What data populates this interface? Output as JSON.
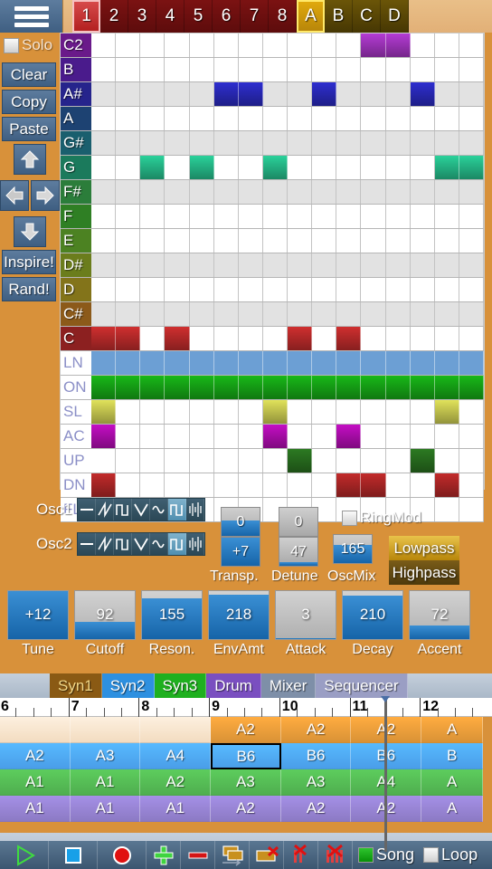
{
  "topbar": {
    "menu_icon": "hamburger-icon",
    "pattern_tabs": [
      {
        "label": "1",
        "type": "num",
        "selected": true
      },
      {
        "label": "2",
        "type": "num",
        "selected": false
      },
      {
        "label": "3",
        "type": "num",
        "selected": false
      },
      {
        "label": "4",
        "type": "num",
        "selected": false
      },
      {
        "label": "5",
        "type": "num",
        "selected": false
      },
      {
        "label": "6",
        "type": "num",
        "selected": false
      },
      {
        "label": "7",
        "type": "num",
        "selected": false
      },
      {
        "label": "8",
        "type": "num",
        "selected": false
      },
      {
        "label": "A",
        "type": "alpha",
        "selected": true
      },
      {
        "label": "B",
        "type": "alpha",
        "selected": false
      },
      {
        "label": "C",
        "type": "alpha",
        "selected": false
      },
      {
        "label": "D",
        "type": "alpha",
        "selected": false
      }
    ]
  },
  "sidebar": {
    "solo": {
      "label": "Solo",
      "checked": false
    },
    "buttons": [
      {
        "label": "Clear",
        "name": "clear-button"
      },
      {
        "label": "Copy",
        "name": "copy-button"
      },
      {
        "label": "Paste",
        "name": "paste-button"
      }
    ],
    "nudge": {
      "up": "arrow-up-icon",
      "left": "arrow-left-icon",
      "right": "arrow-right-icon",
      "down": "arrow-down-icon"
    },
    "generate": [
      {
        "label": "Inspire!",
        "name": "inspire-button"
      },
      {
        "label": "Rand!",
        "name": "rand-button"
      }
    ]
  },
  "piano_roll": {
    "columns": 16,
    "note_rows": [
      {
        "label": "C2",
        "color": "#6a1a8a",
        "shade": false,
        "steps": [
          0,
          0,
          0,
          0,
          0,
          0,
          0,
          0,
          0,
          0,
          0,
          1,
          1,
          0,
          0,
          0
        ],
        "note_color": "#b43bd4"
      },
      {
        "label": "B",
        "color": "#4a1b8c",
        "shade": false,
        "steps": [
          0,
          0,
          0,
          0,
          0,
          0,
          0,
          0,
          0,
          0,
          0,
          0,
          0,
          0,
          0,
          0
        ],
        "note_color": "#7a35c8"
      },
      {
        "label": "A#",
        "color": "#26248c",
        "shade": true,
        "steps": [
          0,
          0,
          0,
          0,
          0,
          1,
          1,
          0,
          0,
          1,
          0,
          0,
          0,
          1,
          0,
          0
        ],
        "note_color": "#2e2ecf"
      },
      {
        "label": "A",
        "color": "#1d4272",
        "shade": false,
        "steps": [
          0,
          0,
          0,
          0,
          0,
          0,
          0,
          0,
          0,
          0,
          0,
          0,
          0,
          0,
          0,
          0
        ],
        "note_color": "#2e5ecf"
      },
      {
        "label": "G#",
        "color": "#1a5f6e",
        "shade": true,
        "steps": [
          0,
          0,
          0,
          0,
          0,
          0,
          0,
          0,
          0,
          0,
          0,
          0,
          0,
          0,
          0,
          0
        ],
        "note_color": "#2a9ab0"
      },
      {
        "label": "G",
        "color": "#1b7a5c",
        "shade": false,
        "steps": [
          0,
          0,
          1,
          0,
          1,
          0,
          0,
          1,
          0,
          0,
          0,
          0,
          0,
          0,
          1,
          1
        ],
        "note_color": "#2ad19a"
      },
      {
        "label": "F#",
        "color": "#2b7d3a",
        "shade": true,
        "steps": [
          0,
          0,
          0,
          0,
          0,
          0,
          0,
          0,
          0,
          0,
          0,
          0,
          0,
          0,
          0,
          0
        ],
        "note_color": "#35c255"
      },
      {
        "label": "F",
        "color": "#2f7f24",
        "shade": false,
        "steps": [
          0,
          0,
          0,
          0,
          0,
          0,
          0,
          0,
          0,
          0,
          0,
          0,
          0,
          0,
          0,
          0
        ],
        "note_color": "#46c13a"
      },
      {
        "label": "E",
        "color": "#4c8222",
        "shade": false,
        "steps": [
          0,
          0,
          0,
          0,
          0,
          0,
          0,
          0,
          0,
          0,
          0,
          0,
          0,
          0,
          0,
          0
        ],
        "note_color": "#72c23a"
      },
      {
        "label": "D#",
        "color": "#6b7d1c",
        "shade": true,
        "steps": [
          0,
          0,
          0,
          0,
          0,
          0,
          0,
          0,
          0,
          0,
          0,
          0,
          0,
          0,
          0,
          0
        ],
        "note_color": "#b0c03a"
      },
      {
        "label": "D",
        "color": "#83741a",
        "shade": false,
        "steps": [
          0,
          0,
          0,
          0,
          0,
          0,
          0,
          0,
          0,
          0,
          0,
          0,
          0,
          0,
          0,
          0
        ],
        "note_color": "#ccb63a"
      },
      {
        "label": "C#",
        "color": "#8c5a1a",
        "shade": true,
        "steps": [
          0,
          0,
          0,
          0,
          0,
          0,
          0,
          0,
          0,
          0,
          0,
          0,
          0,
          0,
          0,
          0
        ],
        "note_color": "#d99a3a"
      },
      {
        "label": "C",
        "color": "#8c2020",
        "shade": false,
        "steps": [
          1,
          1,
          0,
          1,
          0,
          0,
          0,
          0,
          1,
          0,
          1,
          0,
          0,
          0,
          0,
          0
        ],
        "note_color": "#cf2f2f"
      }
    ],
    "control_rows": [
      {
        "label": "LN",
        "shade": false,
        "full": true,
        "steps": [
          1,
          1,
          1,
          1,
          1,
          1,
          1,
          1,
          1,
          1,
          1,
          1,
          1,
          1,
          1,
          1
        ],
        "note_color": "#6c9fd4"
      },
      {
        "label": "ON",
        "shade": false,
        "full": false,
        "steps": [
          1,
          1,
          1,
          1,
          1,
          1,
          1,
          1,
          1,
          1,
          1,
          1,
          1,
          1,
          1,
          1
        ],
        "note_color": "#18b818"
      },
      {
        "label": "SL",
        "shade": false,
        "full": false,
        "steps": [
          1,
          0,
          0,
          0,
          0,
          0,
          0,
          1,
          0,
          0,
          0,
          0,
          0,
          0,
          1,
          0
        ],
        "note_color": "#e0e25a"
      },
      {
        "label": "AC",
        "shade": false,
        "full": false,
        "steps": [
          1,
          0,
          0,
          0,
          0,
          0,
          0,
          1,
          0,
          0,
          1,
          0,
          0,
          0,
          0,
          0
        ],
        "note_color": "#c40ec4"
      },
      {
        "label": "UP",
        "shade": false,
        "full": false,
        "steps": [
          0,
          0,
          0,
          0,
          0,
          0,
          0,
          0,
          1,
          0,
          0,
          0,
          0,
          1,
          0,
          0
        ],
        "note_color": "#2c7a22"
      },
      {
        "label": "DN",
        "shade": false,
        "full": false,
        "steps": [
          1,
          0,
          0,
          0,
          0,
          0,
          0,
          0,
          0,
          0,
          1,
          1,
          0,
          0,
          1,
          0
        ],
        "note_color": "#c22b2b"
      },
      {
        "label": "FL",
        "shade": false,
        "full": false,
        "steps": [
          0,
          0,
          0,
          0,
          0,
          0,
          0,
          0,
          0,
          0,
          0,
          0,
          0,
          0,
          0,
          0
        ],
        "note_color": "#cccccc"
      }
    ]
  },
  "synth": {
    "osc1": {
      "label": "Osc1",
      "selected_wave": 5
    },
    "osc2": {
      "label": "Osc2",
      "selected_wave": 5
    },
    "waveforms": [
      "flat-wave-icon",
      "saw-wave-icon",
      "pulse-wave-icon",
      "triangle-wave-icon",
      "sine-wave-icon",
      "square-wave-icon",
      "noise-wave-icon"
    ],
    "transpose": {
      "caption": "Transp.",
      "osc1": "0",
      "osc2": "+7",
      "osc1_fill": 55,
      "osc2_fill": 100
    },
    "detune": {
      "caption": "Detune",
      "osc1": "0",
      "osc2": "47",
      "osc1_fill": 0,
      "osc2_fill": 14
    },
    "oscmix": {
      "caption": "OscMix",
      "value": "165",
      "fill": 65
    },
    "ringmod": {
      "label": "RingMod",
      "checked": false
    },
    "filter": {
      "lowpass": "Lowpass",
      "highpass": "Highpass",
      "active": "Lowpass"
    },
    "sliders": [
      {
        "caption": "Tune",
        "value": "+12",
        "fill": 100
      },
      {
        "caption": "Cutoff",
        "value": "92",
        "fill": 36
      },
      {
        "caption": "Reson.",
        "value": "155",
        "fill": 85
      },
      {
        "caption": "EnvAmt",
        "value": "218",
        "fill": 92
      },
      {
        "caption": "Attack",
        "value": "3",
        "fill": 2
      },
      {
        "caption": "Decay",
        "value": "210",
        "fill": 90
      },
      {
        "caption": "Accent",
        "value": "72",
        "fill": 28
      }
    ]
  },
  "view_tabs": [
    {
      "label": "Syn1",
      "color": "#8a5a14",
      "text": "#f3d887",
      "selected": true
    },
    {
      "label": "Syn2",
      "color": "#2e90e0",
      "text": "#ffffff",
      "selected": false
    },
    {
      "label": "Syn3",
      "color": "#1fb01f",
      "text": "#ffffff",
      "selected": false
    },
    {
      "label": "Drum",
      "color": "#7a4fc0",
      "text": "#ffffff",
      "selected": false
    },
    {
      "label": "Mixer",
      "color": "#7e8fa8",
      "text": "#ffffff",
      "selected": false
    },
    {
      "label": "Sequencer",
      "color": "#9a9ec4",
      "text": "#ffffff",
      "selected": false
    }
  ],
  "ruler": {
    "marks": [
      "6",
      "7",
      "8",
      "9",
      "10",
      "11",
      "12"
    ],
    "playhead_bar": "11.5"
  },
  "sequencer": {
    "tracks": [
      {
        "name": "syn1-track",
        "color": "#d99236",
        "empty_color": "#f3dcc0",
        "clips": [
          "",
          "",
          "",
          "A2",
          "A2",
          "A2",
          "A"
        ]
      },
      {
        "name": "syn2-track",
        "color": "#4a9ee8",
        "empty_color": "#4a9ee8",
        "clips": [
          "A2",
          "A3",
          "A4",
          "B6",
          "B6",
          "B6",
          "B"
        ],
        "selected_index": 3
      },
      {
        "name": "syn3-track",
        "color": "#4fae4f",
        "empty_color": "#4fae4f",
        "clips": [
          "A1",
          "A1",
          "A2",
          "A3",
          "A3",
          "A4",
          "A"
        ]
      },
      {
        "name": "drum-track",
        "color": "#8c7ac4",
        "empty_color": "#8c7ac4",
        "clips": [
          "A1",
          "A1",
          "A1",
          "A2",
          "A2",
          "A2",
          "A"
        ]
      }
    ]
  },
  "transport": {
    "buttons": [
      {
        "name": "play-button",
        "icon": "play-icon"
      },
      {
        "name": "stop-button",
        "icon": "stop-icon"
      },
      {
        "name": "record-button",
        "icon": "record-icon"
      },
      {
        "name": "add-button",
        "icon": "plus-icon"
      },
      {
        "name": "remove-button",
        "icon": "minus-icon"
      },
      {
        "name": "copy-clip-button",
        "icon": "copy-icon"
      },
      {
        "name": "paste-clip-button",
        "icon": "paste-icon"
      },
      {
        "name": "delete-clip-button",
        "icon": "delete-one-icon"
      },
      {
        "name": "delete-all-button",
        "icon": "delete-all-icon"
      }
    ],
    "song": {
      "label": "Song",
      "checked": true
    },
    "loop": {
      "label": "Loop",
      "checked": false
    }
  }
}
